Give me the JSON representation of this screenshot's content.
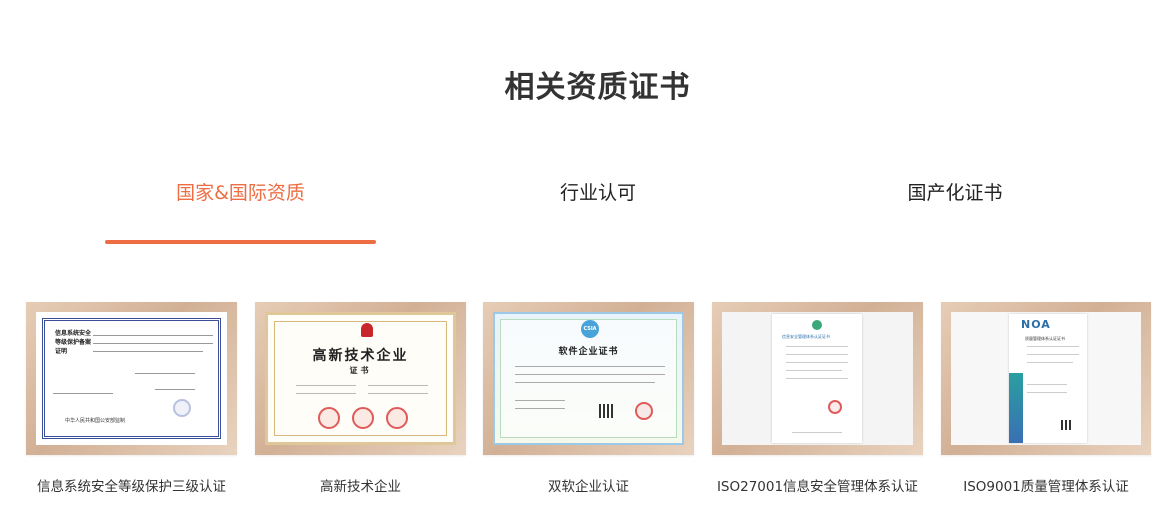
{
  "section": {
    "title": "相关资质证书"
  },
  "tabs": [
    {
      "label": "国家&国际资质",
      "active": true
    },
    {
      "label": "行业认可",
      "active": false
    },
    {
      "label": "国产化证书",
      "active": false
    }
  ],
  "colors": {
    "accent": "#ee6d43",
    "frame": "#d9bda3",
    "text": "#333333"
  },
  "certificates": [
    {
      "caption": "信息系统安全等级保护三级认证",
      "image_text": "信息系统安全等级保护备案证明",
      "image_footer": "中华人民共和国公安部监制"
    },
    {
      "caption": "高新技术企业",
      "image_text": "高新技术企业",
      "image_sub": "证书"
    },
    {
      "caption": "双软企业认证",
      "image_text": "软件企业证书",
      "image_logo": "CSIA"
    },
    {
      "caption": "ISO27001信息安全管理体系认证",
      "image_text": "信息安全管理体系认证证书"
    },
    {
      "caption": "ISO9001质量管理体系认证",
      "image_text": "NOA",
      "image_sub": "质量管理体系认证证书"
    }
  ]
}
